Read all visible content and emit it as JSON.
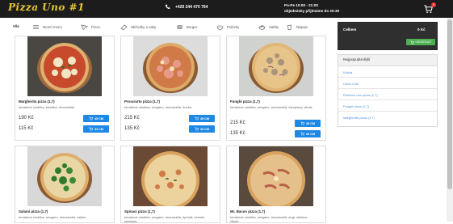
{
  "header": {
    "logo_text": "Pizza Uno #1",
    "phone": "+420 244 470 764",
    "hours_line1": "Po-Pe 10:00 - 21:00",
    "hours_line2": "objednávky přijímáme do 20:30",
    "cart_count": "0",
    "colors": {
      "bar": "#1c1c1c",
      "logo": "#e6c832",
      "badge": "#e53935"
    }
  },
  "categories": [
    {
      "label": "Vše",
      "icon": "none",
      "active": true
    },
    {
      "label": "Denní menu",
      "icon": "list-icon",
      "active": false
    },
    {
      "label": "Pizza",
      "icon": "pizza-slice-icon",
      "active": false
    },
    {
      "label": "Sbírodky a saky",
      "icon": "wrap-icon",
      "active": false
    },
    {
      "label": "Burger",
      "icon": "burger-icon",
      "active": false
    },
    {
      "label": "Polévky",
      "icon": "soup-bowl-icon",
      "active": false
    },
    {
      "label": "Saláty",
      "icon": "salad-bowl-icon",
      "active": false
    },
    {
      "label": "Nápoje",
      "icon": "drink-icon",
      "active": false
    }
  ],
  "products": [
    {
      "name": "Margherita pizza (1,7)",
      "desc": "tomatová omáčka, bazalka, mozzarella",
      "price_big": "190 Kč",
      "price_small": "115 Kč",
      "btn_big": "45 CM",
      "btn_small": "33 CM",
      "pizza": "margherita"
    },
    {
      "name": "Prosciutto pizza (1,7)",
      "desc": "tomatová omáčka, oregano, mozzarella, šunka",
      "price_big": "215 Kč",
      "price_small": "135 Kč",
      "btn_big": "45 CM",
      "btn_small": "33 CM",
      "pizza": "prosciutto"
    },
    {
      "name": "Funghi pizza (1,7)",
      "desc": "tomatová omáčka, oregano, mozzarella, žampiony, cibule",
      "price_big": "215 Kč",
      "price_small": "135 Kč",
      "btn_big": "45 CM",
      "btn_small": "33 CM",
      "pizza": "funghi"
    },
    {
      "name": "Salami pizza (1,7)",
      "desc": "tomatová omáčka, oregano, mozzarella, salám",
      "pizza": "salami"
    },
    {
      "name": "Spinaci pizza (1,7)",
      "desc": "tomatová omáčka, oregano, mozzarella, špenát, česnek, smetana",
      "pizza": "spinaci"
    },
    {
      "name": "Mr. Bacon pizza (1,7)",
      "desc": "tomatová omáčka, oregano, mozzarella, angl. slanina, cibule",
      "pizza": "bacon"
    }
  ],
  "cart_panel": {
    "label": "Celkem",
    "total": "0 Kč",
    "order_button": "OBJEDNAT"
  },
  "popular": {
    "title": "Nejpopulárnější",
    "items": [
      "Kofola",
      "Coca Cola",
      "Romeno uno pizza (1,7)",
      "Funghi pizza (1,7)",
      "Margherita pizza (1,7)"
    ]
  },
  "colors": {
    "accent_blue": "#1e88e5",
    "link_blue": "#4a90d9",
    "order_green": "#4caf50",
    "panel_dark": "#2f2f2f"
  }
}
